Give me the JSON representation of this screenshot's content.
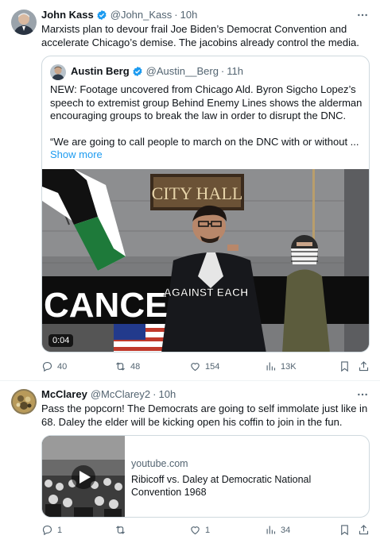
{
  "tweet1": {
    "author_name": "John Kass",
    "author_handle": "@John_Kass",
    "time": "10h",
    "text": "Marxists plan to devour frail Joe Biden’s  Democrat Convention and accelerate Chicago’s demise. The jacobins already control the media.",
    "quote": {
      "author_name": "Austin Berg",
      "author_handle": "@Austin__Berg",
      "time": "11h",
      "paragraph1": "NEW: Footage uncovered from Chicago Ald. Byron Sigcho Lopez’s speech to extremist group Behind Enemy Lines shows the alderman encouraging groups to break the law in order to disrupt the DNC.",
      "paragraph2": "“We are going to call people to march on the DNC with or without ...",
      "show_more": "Show more",
      "video": {
        "duration": "0:04",
        "sign_text": "CITY HALL",
        "caption_text": "AGAINST EACH",
        "banner_text": "CANCEL T"
      }
    },
    "actions": {
      "replies": "40",
      "reposts": "48",
      "likes": "154",
      "views": "13K"
    }
  },
  "tweet2": {
    "author_name": "McClarey",
    "author_handle": "@McClarey2",
    "time": "10h",
    "text": "Pass the popcorn!  The Democrats are going to self immolate just like in 68. Daley the elder will be kicking open his coffin to join in the fun.",
    "card": {
      "domain": "youtube.com",
      "title": "Ribicoff vs. Daley at Democratic National Convention 1968"
    },
    "actions": {
      "replies": "1",
      "reposts": "",
      "likes": "1",
      "views": "34"
    }
  },
  "colors": {
    "text": "#0f1419",
    "secondary": "#536471",
    "accent": "#1d9bf0",
    "border": "#cfd9de"
  },
  "icons": [
    "verified-badge-icon",
    "more-icon",
    "reply-icon",
    "repost-icon",
    "like-icon",
    "views-icon",
    "bookmark-icon",
    "share-icon",
    "play-icon"
  ]
}
